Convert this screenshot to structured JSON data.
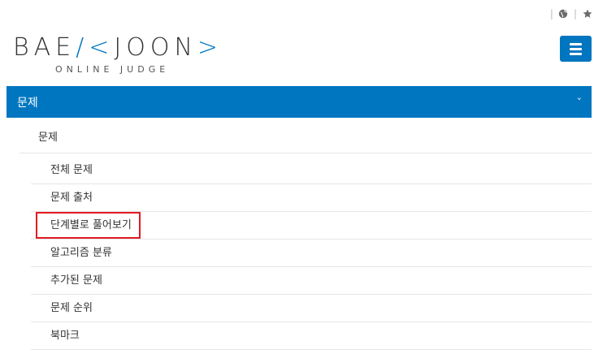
{
  "topbar": {
    "globe_icon": "globe-icon",
    "star_icon": "star-icon",
    "separator": "|"
  },
  "logo": {
    "main_left": "BAE",
    "main_mid": "/<",
    "main_right": "JOON",
    "main_end": ">",
    "sub": "ONLINE JUDGE"
  },
  "nav": {
    "menu_icon": "hamburger-menu-icon",
    "section_title": "문제",
    "chevron": "˅",
    "group_title": "문제",
    "items": [
      {
        "label": "전체 문제"
      },
      {
        "label": "문제 출처"
      },
      {
        "label": "단계별로 풀어보기"
      },
      {
        "label": "알고리즘 분류"
      },
      {
        "label": "추가된 문제"
      },
      {
        "label": "문제 순위"
      },
      {
        "label": "북마크"
      }
    ]
  },
  "colors": {
    "brand": "#0076c0",
    "highlight": "#e21b22"
  }
}
